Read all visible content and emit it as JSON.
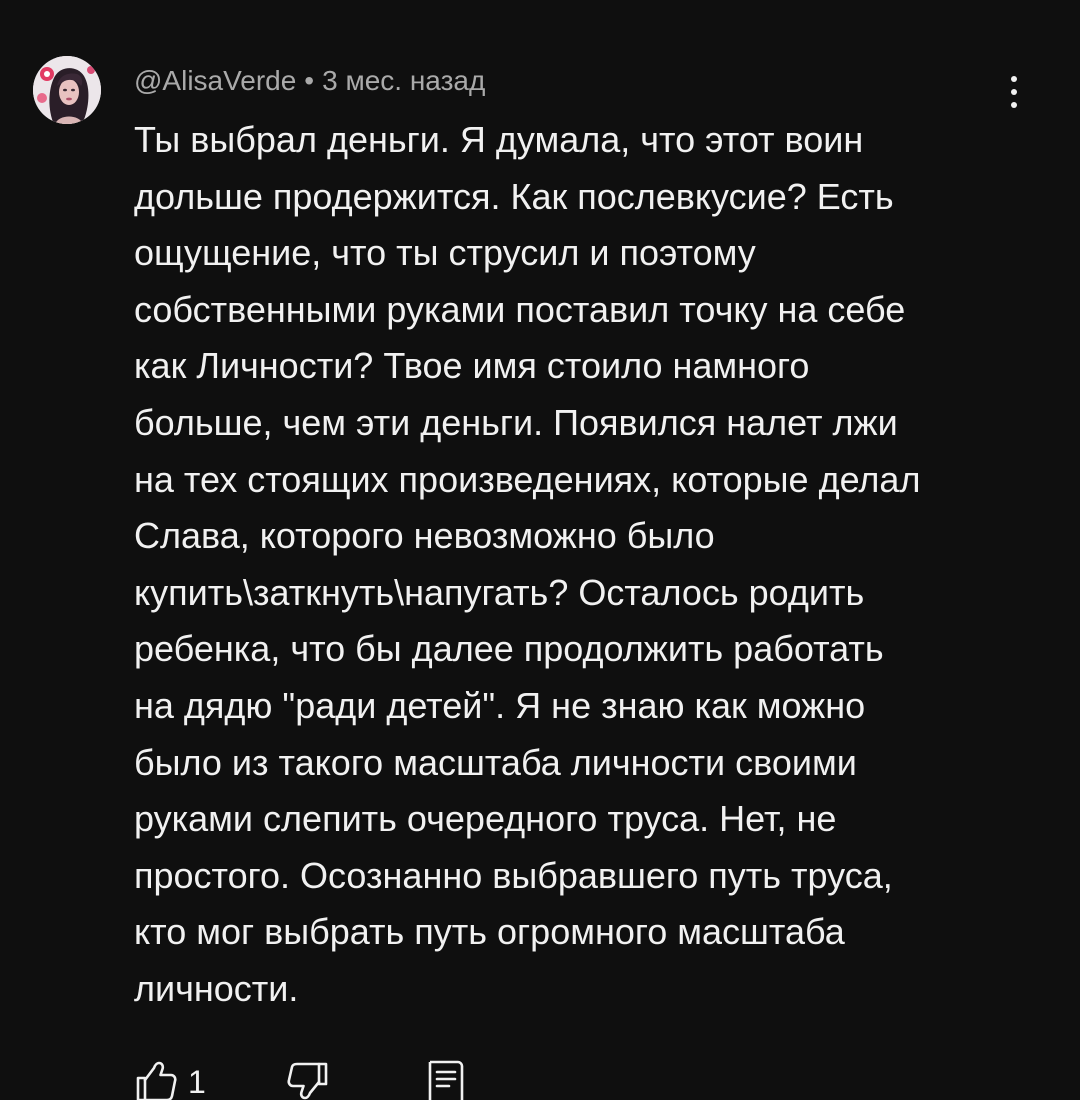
{
  "comment": {
    "author": "@AlisaVerde",
    "separator": "•",
    "time": "3 мес. назад",
    "text": "Ты выбрал деньги. Я думала, что этот воин\nдольше продержится.  Как послевкусие? Есть\nощущение, что ты струсил и поэтому\nсобственными руками поставил точку на себе\nкак Личности? Твое имя стоило намного\nбольше, чем эти деньги. Появился налет лжи\nна тех стоящих произведениях, которые делал\nСлава, которого невозможно было\nкупить\\заткнуть\\напугать? Осталось родить\nребенка, что бы далее продолжить работать\nна дядю \"ради детей\". Я не знаю как можно\nбыло из такого масштаба личности своими\nруками слепить очередного труса. Нет, не\nпростого.  Осознанно выбравшего путь труса,\nкто мог выбрать путь огромного масштаба\nличности.",
    "likes": "1"
  },
  "icons": {
    "avatar": "avatar-image",
    "menu": "more-vert-icon",
    "like": "thumb-up-icon",
    "dislike": "thumb-down-icon",
    "reply": "reply-comment-icon"
  },
  "colors": {
    "background": "#0f0f0f",
    "text": "#f1f1f1",
    "meta": "#aaaaaa"
  }
}
